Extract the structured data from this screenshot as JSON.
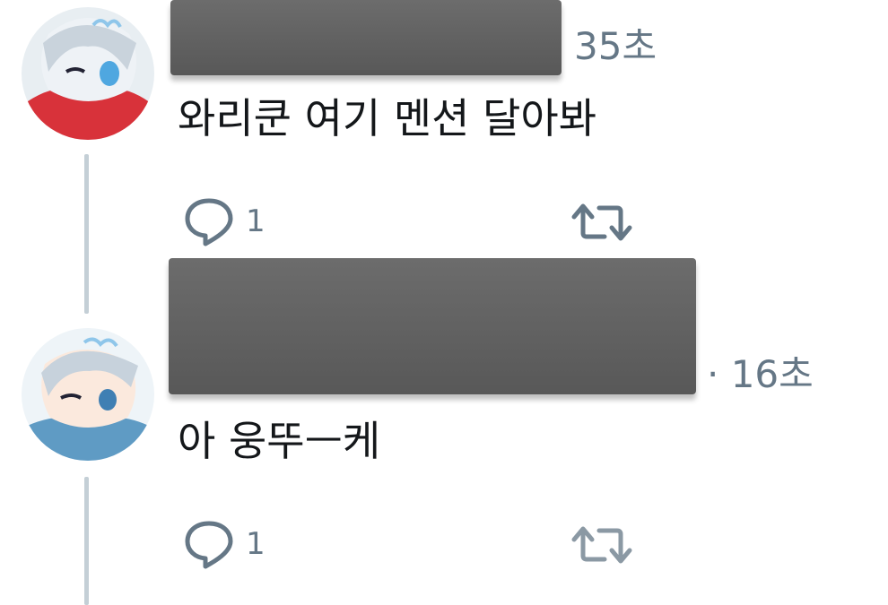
{
  "colors": {
    "text": "#14171a",
    "muted": "#657786",
    "thread_line": "#c4cfd6",
    "redaction": "#606060"
  },
  "tweets": [
    {
      "timestamp": "35초",
      "text": "와리쿤 여기 멘션 달아봐",
      "reply_count": "1",
      "reply_icon": "reply-icon",
      "retweet_icon": "retweet-icon"
    },
    {
      "timestamp": "· 16초",
      "text": "아 웅뚜ㅡ케",
      "reply_count": "1",
      "reply_icon": "reply-icon",
      "retweet_icon": "retweet-icon"
    }
  ]
}
